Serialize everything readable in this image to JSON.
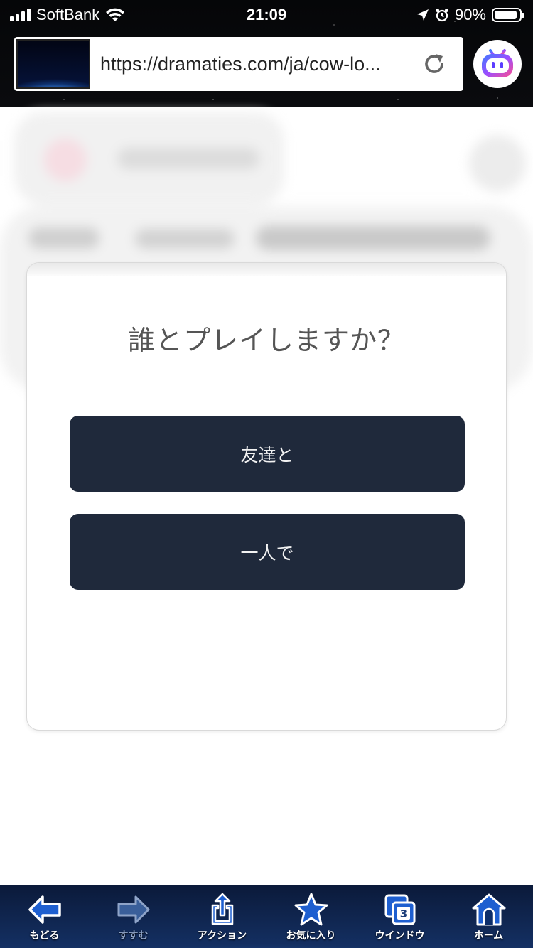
{
  "status_bar": {
    "carrier": "SoftBank",
    "time": "21:09",
    "battery": "90%",
    "battery_level": 0.9,
    "signal_bars": 4
  },
  "browser": {
    "url": "https://dramaties.com/ja/cow-lo..."
  },
  "modal": {
    "title": "誰とプレイしますか？",
    "options": [
      {
        "label": "友達と"
      },
      {
        "label": "一人で"
      }
    ]
  },
  "toolbar": {
    "items": [
      {
        "label": "もどる",
        "icon": "back-arrow-icon",
        "enabled": true
      },
      {
        "label": "すすむ",
        "icon": "forward-arrow-icon",
        "enabled": false
      },
      {
        "label": "アクション",
        "icon": "share-icon",
        "enabled": true
      },
      {
        "label": "お気に入り",
        "icon": "star-icon",
        "enabled": true
      },
      {
        "label": "ウインドウ",
        "icon": "windows-icon",
        "enabled": true,
        "badge": "3"
      },
      {
        "label": "ホーム",
        "icon": "home-icon",
        "enabled": true
      }
    ]
  },
  "colors": {
    "button_bg": "#1f293b",
    "toolbar_icon": "#1e5fd0"
  }
}
